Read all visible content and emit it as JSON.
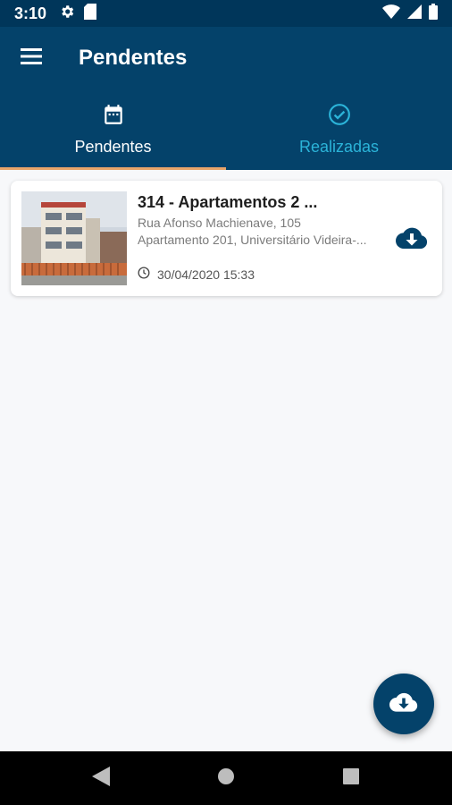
{
  "status_bar": {
    "time": "3:10",
    "icons": [
      "settings-icon",
      "sd-card-icon",
      "wifi-icon",
      "signal-icon",
      "battery-icon"
    ]
  },
  "app_bar": {
    "title": "Pendentes",
    "menu_icon": "hamburger-menu-icon"
  },
  "tabs": [
    {
      "label": "Pendentes",
      "icon": "calendar-icon",
      "active": true
    },
    {
      "label": "Realizadas",
      "icon": "check-circle-icon",
      "active": false
    }
  ],
  "list": {
    "items": [
      {
        "title": "314 - Apartamentos 2 ...",
        "address_line1": "Rua Afonso Machienave, 105",
        "address_line2": "Apartamento 201, Universitário Videira-...",
        "datetime": "30/04/2020 15:33",
        "thumbnail": "building-photo",
        "action_icon": "cloud-download-icon"
      }
    ]
  },
  "fab": {
    "icon": "cloud-download-icon"
  },
  "nav_bar": {
    "icons": [
      "back-icon",
      "home-icon",
      "recents-icon"
    ]
  },
  "colors": {
    "primary": "#04426a",
    "status_bar": "#00365a",
    "tab_inactive": "#2bb3d8",
    "tab_indicator": "#e8a46a",
    "background": "#f7f8fa"
  }
}
